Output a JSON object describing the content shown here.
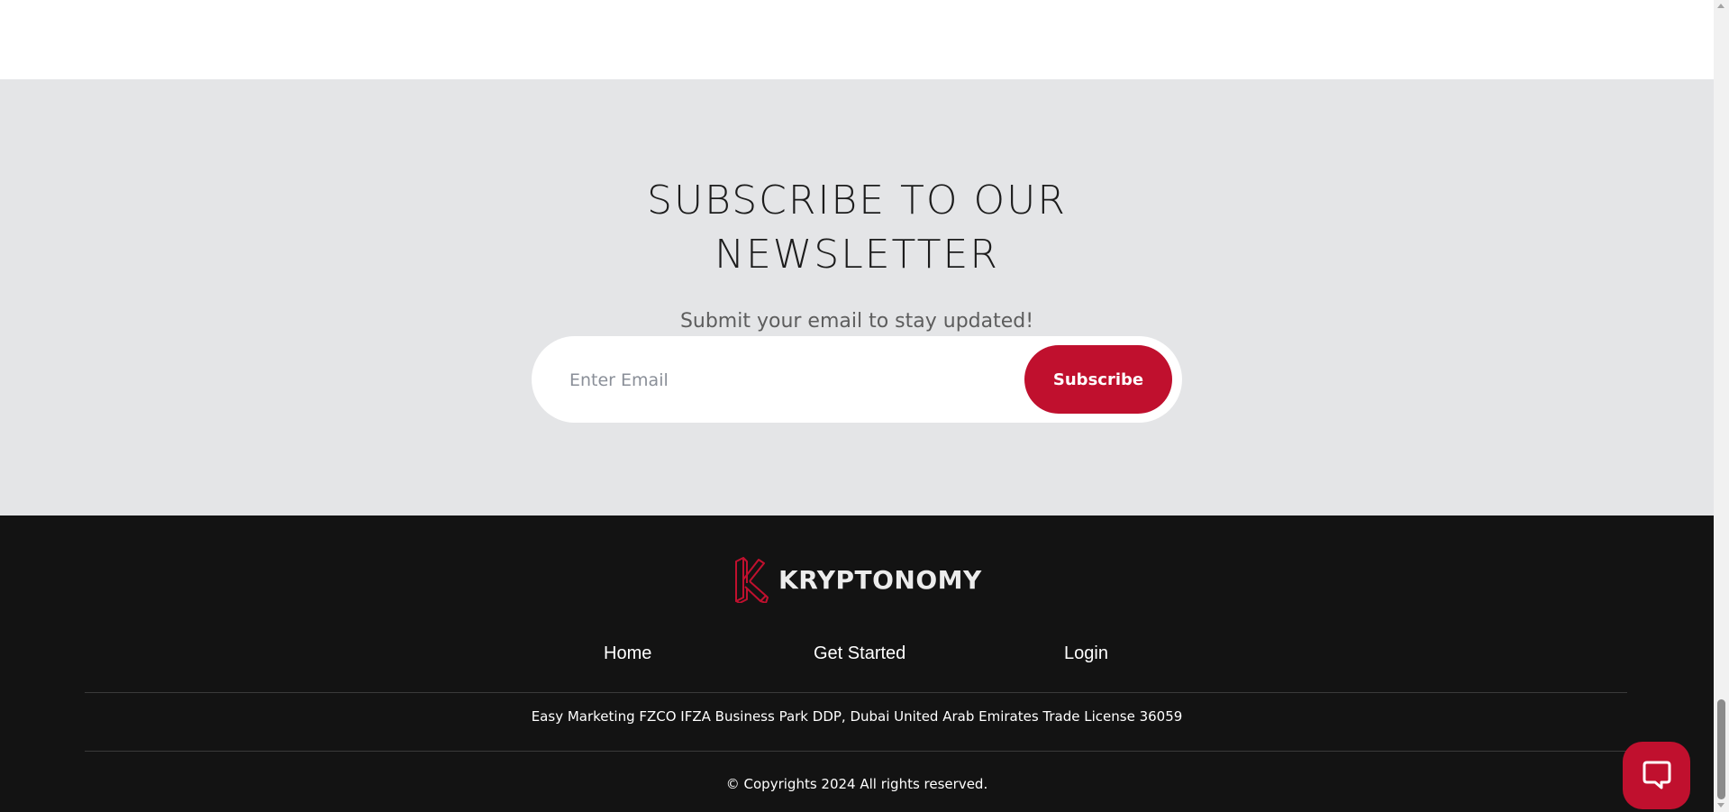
{
  "newsletter": {
    "title_line1": "SUBSCRIBE TO OUR",
    "title_line2": "NEWSLETTER",
    "subtitle": "Submit your email to stay updated!",
    "email_placeholder": "Enter Email",
    "subscribe_label": "Subscribe"
  },
  "footer": {
    "logo_text": "KRYPTONOMY",
    "nav": {
      "home": "Home",
      "get_started": "Get Started",
      "login": "Login"
    },
    "address": "Easy Marketing FZCO IFZA Business Park DDP, Dubai United Arab Emirates Trade License 36059",
    "copyright": "© Copyrights 2024 All rights reserved."
  },
  "widgets": {
    "chat_icon": "chat-bubble-icon"
  },
  "colors": {
    "accent": "#c0102e",
    "newsletter_bg": "#e4e5e7",
    "footer_bg": "#131313"
  }
}
